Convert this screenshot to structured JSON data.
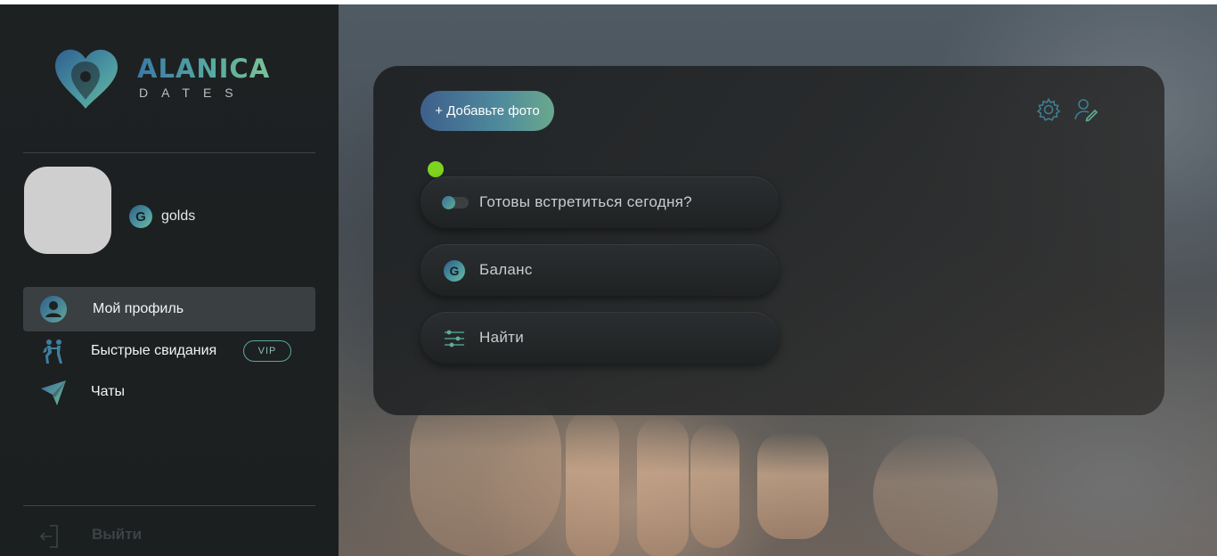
{
  "brand": {
    "name": "ALANICA",
    "sub": "DATES"
  },
  "user": {
    "username": "golds",
    "coin_symbol": "G"
  },
  "nav": {
    "items": [
      {
        "label": "Мой профиль",
        "icon": "user-icon",
        "active": true
      },
      {
        "label": "Быстрые свидания",
        "icon": "running-people-icon",
        "badge": "VIP"
      },
      {
        "label": "Чаты",
        "icon": "paper-plane-icon"
      }
    ],
    "logout_label": "Выйти"
  },
  "card": {
    "add_photo_label": "+ Добавьте фото",
    "ready_label": "Готовы встретиться сегодня?",
    "balance_label": "Баланс",
    "find_label": "Найти",
    "online_status_color": "#7ed321"
  },
  "colors": {
    "accent_blue": "#3c78a6",
    "accent_green": "#73b89a",
    "sidebar_bg": "#1d2122"
  }
}
